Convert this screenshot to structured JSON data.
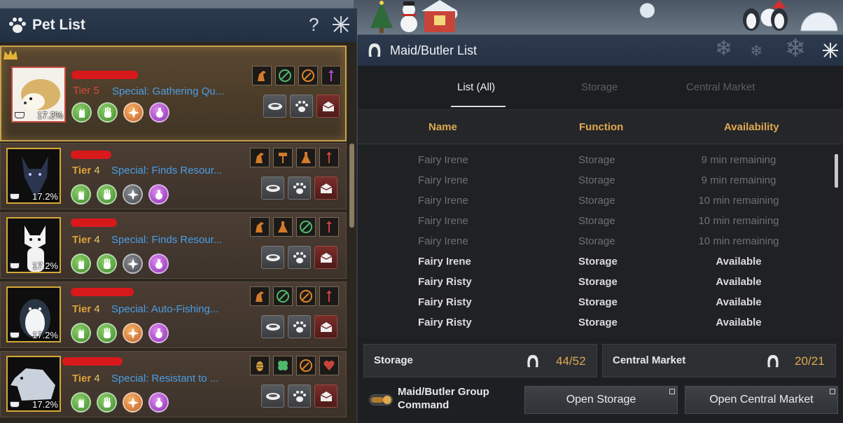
{
  "pet_list": {
    "title": "Pet List",
    "help_label": "?",
    "pets": [
      {
        "tier_label": "Tier",
        "tier_value": "5",
        "special": "Special: Gathering Qu...",
        "feed": "17.2%",
        "round_icons": [
          "cat-icon",
          "hand-icon",
          "compass-icon",
          "potion-icon"
        ],
        "round_colors": [
          "green",
          "green",
          "orange",
          "purple"
        ]
      },
      {
        "tier_label": "Tier",
        "tier_value": "4",
        "special": "Special: Finds Resour...",
        "feed": "17.2%",
        "round_icons": [
          "cat-icon",
          "hand-icon",
          "compass-icon",
          "potion-icon"
        ],
        "round_colors": [
          "green",
          "green",
          "gray",
          "purple"
        ]
      },
      {
        "tier_label": "Tier",
        "tier_value": "4",
        "special": "Special: Finds Resour...",
        "feed": "17.2%",
        "round_icons": [
          "cat-icon",
          "hand-icon",
          "compass-icon",
          "potion-icon"
        ],
        "round_colors": [
          "green",
          "green",
          "gray",
          "purple"
        ]
      },
      {
        "tier_label": "Tier",
        "tier_value": "4",
        "special": "Special: Auto-Fishing...",
        "feed": "17.2%",
        "round_icons": [
          "cat-icon",
          "hand-icon",
          "compass-icon",
          "potion-icon"
        ],
        "round_colors": [
          "green",
          "green",
          "orange",
          "purple"
        ]
      },
      {
        "tier_label": "Tier",
        "tier_value": "4",
        "special": "Special: Resistant to ...",
        "feed": "17.2%",
        "round_icons": [
          "cat-icon",
          "hand-icon",
          "compass-icon",
          "potion-icon"
        ],
        "round_colors": [
          "green",
          "green",
          "orange",
          "purple"
        ]
      }
    ]
  },
  "maid_list": {
    "title": "Maid/Butler List",
    "tabs": [
      "List (All)",
      "Storage",
      "Central Market"
    ],
    "columns": [
      "Name",
      "Function",
      "Availability"
    ],
    "rows": [
      {
        "name": "Fairy Irene",
        "function": "Storage",
        "availability": "9 min remaining",
        "available": false
      },
      {
        "name": "Fairy Irene",
        "function": "Storage",
        "availability": "9 min remaining",
        "available": false
      },
      {
        "name": "Fairy Irene",
        "function": "Storage",
        "availability": "10 min remaining",
        "available": false
      },
      {
        "name": "Fairy Irene",
        "function": "Storage",
        "availability": "10 min remaining",
        "available": false
      },
      {
        "name": "Fairy Irene",
        "function": "Storage",
        "availability": "10 min remaining",
        "available": false
      },
      {
        "name": "Fairy Irene",
        "function": "Storage",
        "availability": "Available",
        "available": true
      },
      {
        "name": "Fairy Risty",
        "function": "Storage",
        "availability": "Available",
        "available": true
      },
      {
        "name": "Fairy Risty",
        "function": "Storage",
        "availability": "Available",
        "available": true
      },
      {
        "name": "Fairy Risty",
        "function": "Storage",
        "availability": "Available",
        "available": true
      }
    ],
    "storage": {
      "label": "Storage",
      "count": "44/52"
    },
    "market": {
      "label": "Central Market",
      "count": "20/21"
    },
    "group_command": {
      "line1": "Maid/Butler Group",
      "line2": "Command",
      "enabled": true
    },
    "open_storage": "Open Storage",
    "open_market": "Open Central Market"
  },
  "colors": {
    "accent_gold": "#e0a94e",
    "special_blue": "#4b9ee6",
    "tier5_red": "#d8483c"
  }
}
